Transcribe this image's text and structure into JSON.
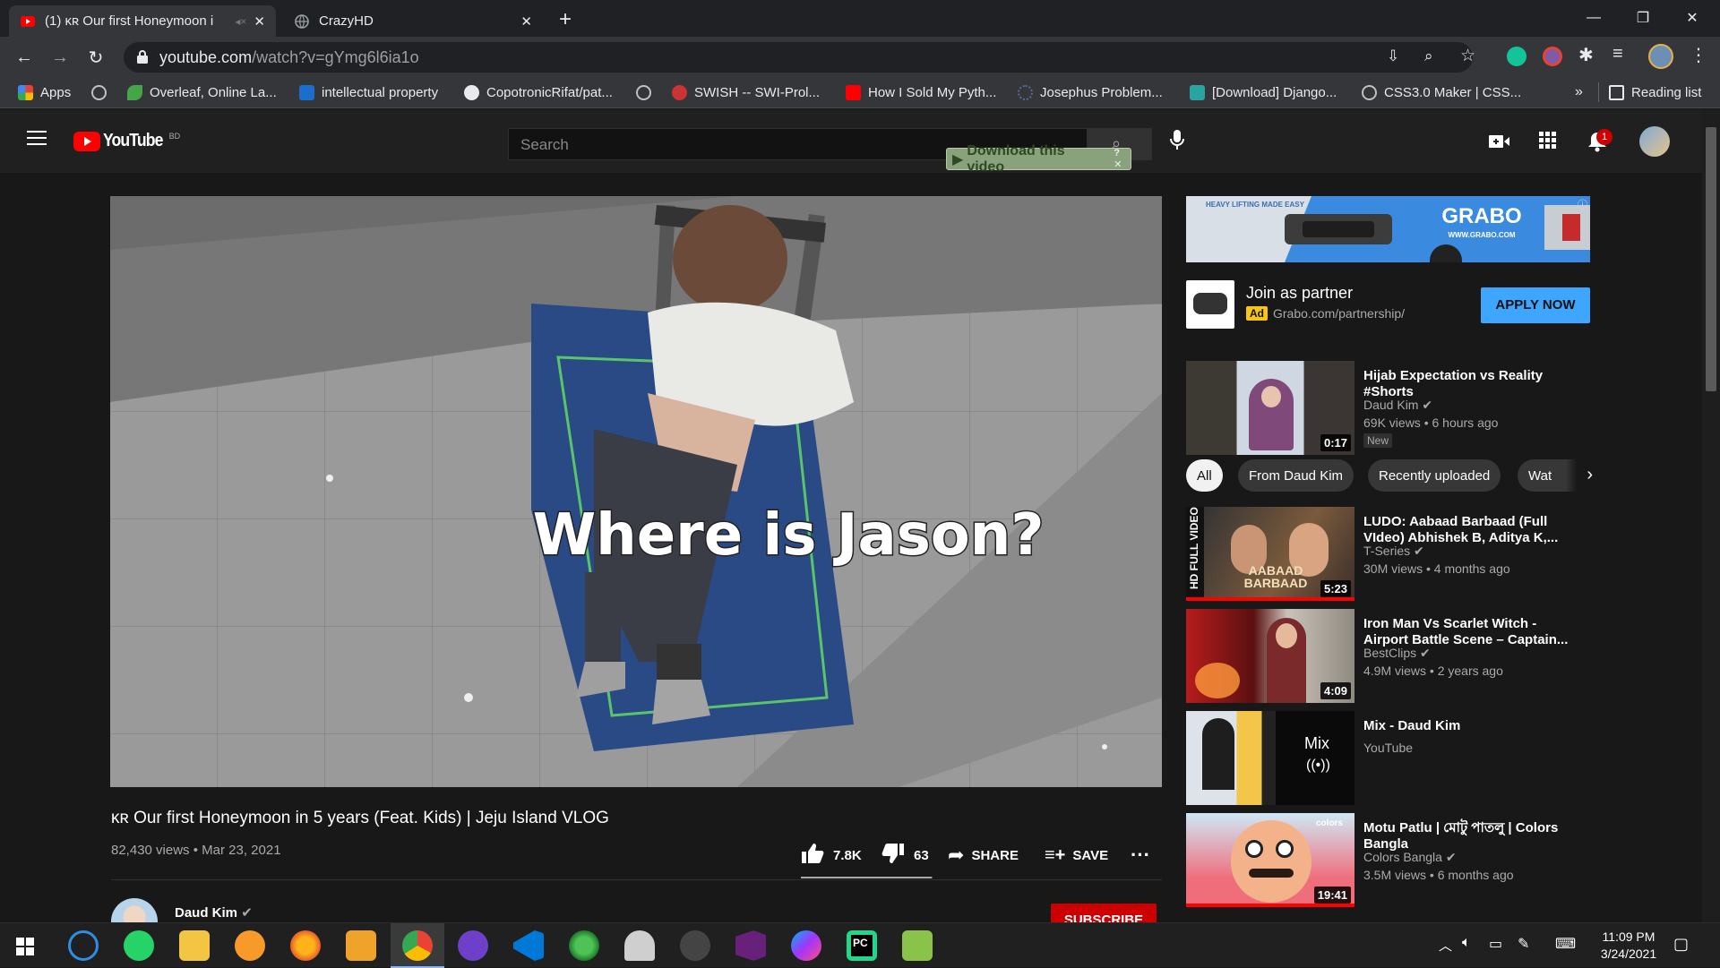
{
  "tabs": [
    {
      "title": "(1) ᴋʀ Our first Honeymoon i",
      "active": true
    },
    {
      "title": "CrazyHD",
      "active": false
    }
  ],
  "address": {
    "host": "youtube.com",
    "path": "/watch?v=gYmg6l6ia1o"
  },
  "bookmarks": [
    {
      "label": "Apps",
      "color": "#e94235"
    },
    {
      "label": "",
      "color": "#c0c0c0"
    },
    {
      "label": "Overleaf, Online La...",
      "color": "#46a546"
    },
    {
      "label": "intellectual property",
      "color": "#1a6fcc"
    },
    {
      "label": "CopotronicRifat/pat...",
      "color": "#e8eaed"
    },
    {
      "label": "",
      "color": "#c0c0c0"
    },
    {
      "label": "SWISH -- SWI-Prol...",
      "color": "#cc3333"
    },
    {
      "label": "How I Sold My Pyth...",
      "color": "#ff0000"
    },
    {
      "label": "Josephus Problem...",
      "color": "#5a6b9f"
    },
    {
      "label": "[Download] Django...",
      "color": "#2aa3a3"
    },
    {
      "label": "CSS3.0 Maker | CSS...",
      "color": "#c0c0c0"
    }
  ],
  "bookmarks_overflow": "»",
  "reading_list": "Reading list",
  "youtube": {
    "logo_text": "YouTube",
    "country": "BD",
    "search_placeholder": "Search",
    "download_bar": "Download this video",
    "notification_count": "1"
  },
  "video": {
    "overlay_text": "Where is Jason?",
    "title": "ᴋʀ Our first Honeymoon in 5 years (Feat. Kids) | Jeju Island VLOG",
    "views": "82,430 views",
    "date": "Mar 23, 2021",
    "likes": "7.8K",
    "dislikes": "63",
    "share": "SHARE",
    "save": "SAVE",
    "like_ratio": 0.992
  },
  "channel": {
    "name": "Daud Kim",
    "subscribe": "SUBSCRIBE"
  },
  "ad": {
    "banner_text": "GRABO",
    "banner_tag": "HEAVY LIFTING MADE EASY",
    "banner_url": "WWW.GRABO.COM",
    "title": "Join as partner",
    "badge": "Ad",
    "url": "Grabo.com/partnership/",
    "cta": "APPLY NOW"
  },
  "related_first": {
    "title": "Hijab Expectation vs Reality #Shorts",
    "channel": "Daud Kim",
    "meta": "69K views • 6 hours ago",
    "badge": "New",
    "duration": "0:17"
  },
  "chips": [
    "All",
    "From Daud Kim",
    "Recently uploaded",
    "Wat"
  ],
  "related": [
    {
      "title": "LUDO: Aabaad Barbaad (Full VIdeo) Abhishek B, Aditya K,...",
      "channel": "T-Series",
      "meta": "30M views • 4 months ago",
      "duration": "5:23",
      "thumb_text": "AABAAD BARBAAD",
      "side_text": "HD FULL VIDEO"
    },
    {
      "title": "Iron Man Vs Scarlet Witch - Airport Battle Scene – Captain...",
      "channel": "BestClips",
      "meta": "4.9M views • 2 years ago",
      "duration": "4:09"
    },
    {
      "title": "Mix - Daud Kim",
      "channel": "YouTube",
      "meta": "",
      "duration": "",
      "mix_label": "Mix"
    },
    {
      "title": "Motu Patlu | মোটু পাতলু | Colors Bangla",
      "channel": "Colors Bangla",
      "meta": "3.5M views • 6 months ago",
      "duration": "19:41",
      "thumb_text": "colors"
    }
  ],
  "taskbar": {
    "time": "11:09 PM",
    "date": "3/24/2021"
  }
}
